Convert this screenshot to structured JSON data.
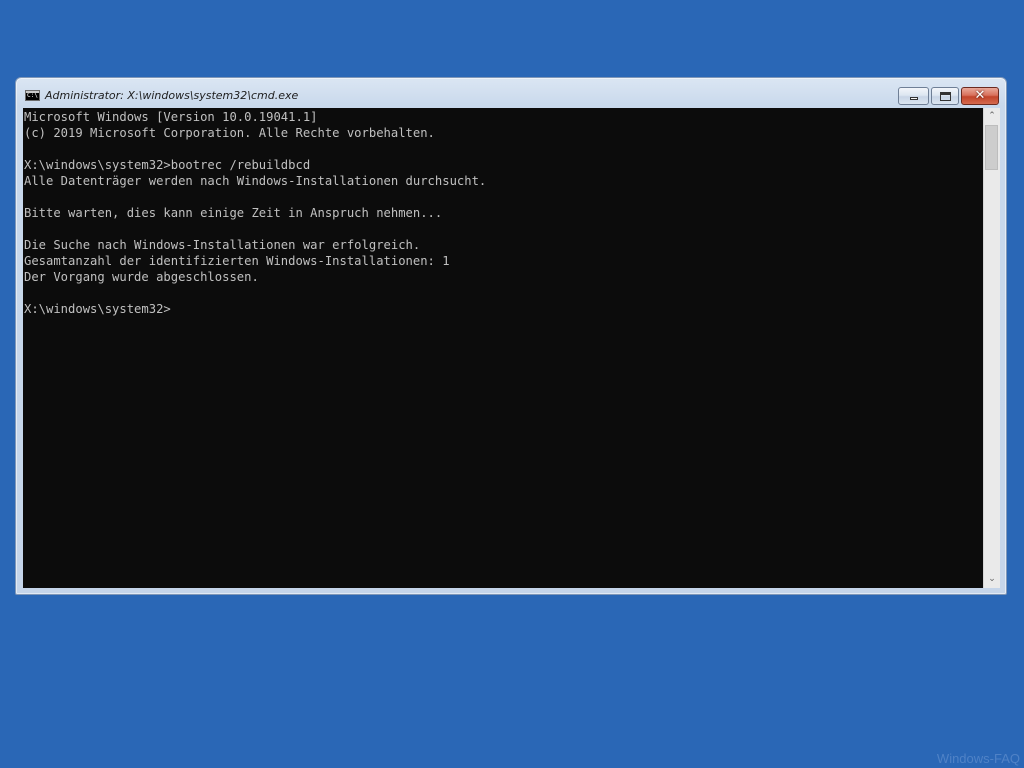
{
  "window": {
    "title": "Administrator: X:\\windows\\system32\\cmd.exe",
    "app_icon": "cmd-icon",
    "app_icon_text": "C:\\"
  },
  "title_buttons": {
    "minimize_icon": "minimize-icon",
    "maximize_icon": "maximize-icon",
    "close_icon": "close-icon",
    "close_glyph": "✕"
  },
  "console": {
    "background": "#0c0c0c",
    "foreground": "#c0c0c0",
    "lines": [
      "Microsoft Windows [Version 10.0.19041.1]",
      "(c) 2019 Microsoft Corporation. Alle Rechte vorbehalten.",
      "",
      "X:\\windows\\system32>bootrec /rebuildbcd",
      "Alle Datenträger werden nach Windows-Installationen durchsucht.",
      "",
      "Bitte warten, dies kann einige Zeit in Anspruch nehmen...",
      "",
      "Die Suche nach Windows-Installationen war erfolgreich.",
      "Gesamtanzahl der identifizierten Windows-Installationen: 1",
      "Der Vorgang wurde abgeschlossen.",
      "",
      "X:\\windows\\system32>"
    ]
  },
  "scrollbar": {
    "up_glyph": "⌃",
    "down_glyph": "⌄",
    "position": 0.0
  },
  "desktop": {
    "background": "#2a67b6"
  },
  "watermark": "Windows-FAQ"
}
